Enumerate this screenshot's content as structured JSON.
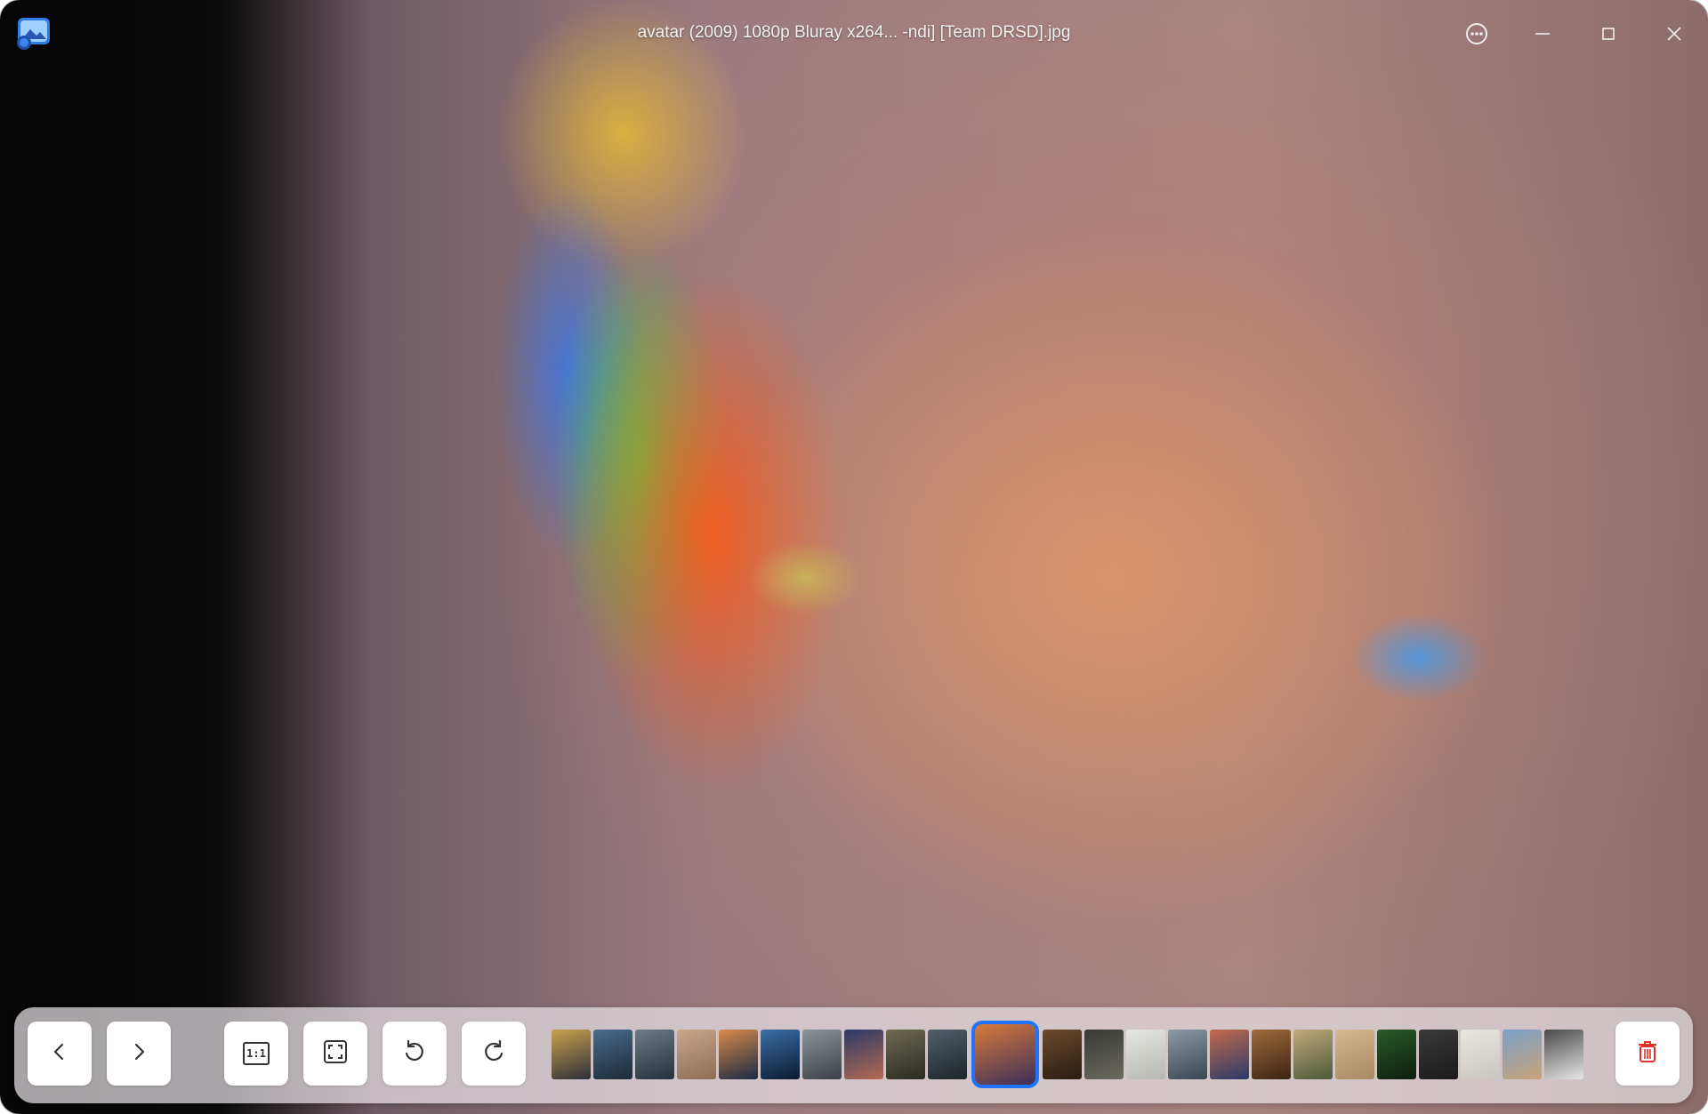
{
  "window": {
    "title": "avatar (2009) 1080p Bluray x264... -ndi] [Team DRSD].jpg"
  },
  "titlebar": {
    "app_icon": "photo-viewer-app-icon",
    "more_icon": "more-options-icon",
    "minimize_icon": "minimize-icon",
    "maximize_icon": "maximize-icon",
    "close_icon": "close-icon"
  },
  "toolbar": {
    "previous_icon": "chevron-left-icon",
    "next_icon": "chevron-right-icon",
    "original_size_label": "1:1",
    "fit_icon": "fit-to-window-icon",
    "rotate_left_icon": "rotate-counterclockwise-icon",
    "rotate_right_icon": "rotate-clockwise-icon",
    "delete_icon": "trash-icon",
    "delete_color": "#e0312a",
    "active_color": "#1f73ff"
  },
  "thumbnails": [
    {
      "colors": [
        "#c9a24c",
        "#2d2f3a"
      ]
    },
    {
      "colors": [
        "#4a6b8c",
        "#1d2a36"
      ]
    },
    {
      "colors": [
        "#6b7b86",
        "#26313a"
      ]
    },
    {
      "colors": [
        "#c9a68a",
        "#8c6e58"
      ]
    },
    {
      "colors": [
        "#d88a4a",
        "#1b2a44"
      ]
    },
    {
      "colors": [
        "#3a6ea8",
        "#0d1a2e"
      ]
    },
    {
      "colors": [
        "#8c949a",
        "#3b4046"
      ]
    },
    {
      "colors": [
        "#2a3a66",
        "#b46a52"
      ]
    },
    {
      "colors": [
        "#6e6a52",
        "#2a2a22"
      ]
    },
    {
      "colors": [
        "#50606a",
        "#1e2428"
      ]
    },
    {
      "colors": [
        "#d97a3a",
        "#3a2e5a"
      ],
      "active": true
    },
    {
      "colors": [
        "#6a4a2e",
        "#2a1c12"
      ]
    },
    {
      "colors": [
        "#3a3a36",
        "#6a6a60"
      ]
    },
    {
      "colors": [
        "#e6e6e2",
        "#b8b8b2"
      ]
    },
    {
      "colors": [
        "#8a9aa6",
        "#3a4650"
      ]
    },
    {
      "colors": [
        "#c46a4a",
        "#2a3a6a"
      ]
    },
    {
      "colors": [
        "#a06a3a",
        "#3a2414"
      ]
    },
    {
      "colors": [
        "#c2a87a",
        "#4a5a3a"
      ]
    },
    {
      "colors": [
        "#d6b890",
        "#a88a62"
      ]
    },
    {
      "colors": [
        "#2a5a2a",
        "#0e1e0e"
      ]
    },
    {
      "colors": [
        "#3a3a3a",
        "#1a1a1a"
      ]
    },
    {
      "colors": [
        "#e8e6e0",
        "#c8c6be"
      ]
    },
    {
      "colors": [
        "#7aa0c8",
        "#c8a47a"
      ]
    },
    {
      "colors": [
        "#4a4a4a",
        "#e6e6e6"
      ]
    }
  ]
}
